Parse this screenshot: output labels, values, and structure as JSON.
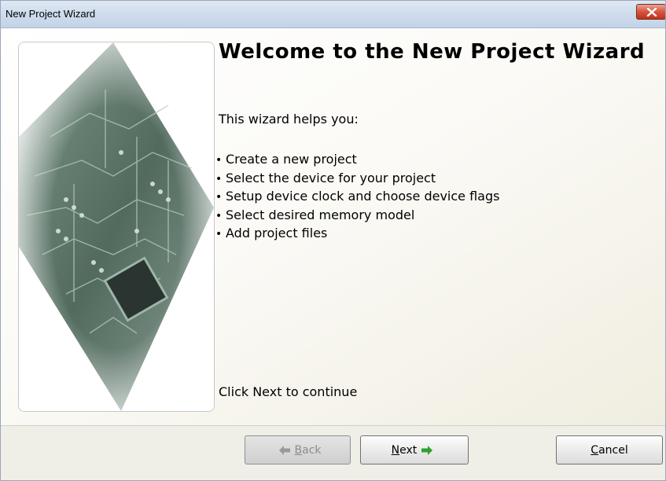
{
  "window": {
    "title": "New Project Wizard"
  },
  "content": {
    "heading": "Welcome to the New Project Wizard",
    "intro": "This wizard helps you:",
    "bullets": [
      "Create a new project",
      "Select the device for your project",
      "Setup device clock and choose device flags",
      "Select desired memory model",
      "Add project files"
    ],
    "footer_text": "Click Next to continue"
  },
  "buttons": {
    "back_mnemonic": "B",
    "back_rest": "ack",
    "next_mnemonic": "N",
    "next_rest": "ext",
    "cancel_mnemonic": "C",
    "cancel_rest": "ancel"
  },
  "icons": {
    "close": "close-icon",
    "back": "arrow-left-icon",
    "next": "arrow-right-icon",
    "illustration": "circuit-board-image"
  },
  "colors": {
    "next_arrow": "#2fa12f",
    "back_arrow_disabled": "#9a9a9a",
    "close_button": "#c8422b"
  }
}
